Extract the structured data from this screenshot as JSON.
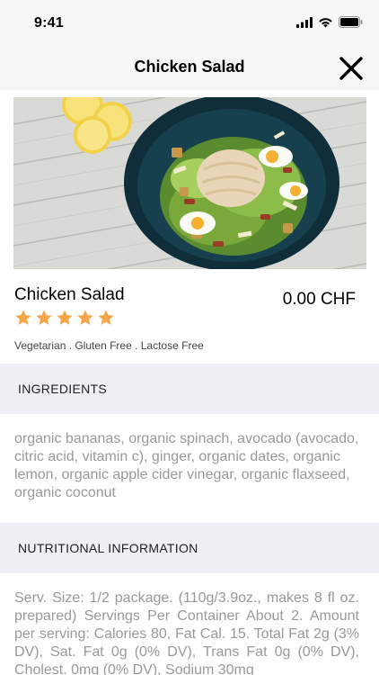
{
  "status_bar": {
    "time": "9:41",
    "icons": [
      "signal-icon",
      "wifi-icon",
      "battery-icon"
    ]
  },
  "nav": {
    "title": "Chicken Salad",
    "close_icon": "close-icon"
  },
  "product": {
    "image": "chicken-salad-photo",
    "name": "Chicken Salad",
    "price": "0.00 CHF",
    "rating": 5,
    "tags": "Vegetarian . Gluten Free . Lactose Free",
    "star_color": "#f2a649"
  },
  "ingredients": {
    "header": "INGREDIENTS",
    "text": "organic bananas, organic spinach, avocado (avocado, citric acid, vitamin c), ginger, organic dates, organic lemon, organic apple cider vinegar, organic flaxseed, organic coconut"
  },
  "nutrition": {
    "header": "NUTRITIONAL INFORMATION",
    "text": "Serv. Size: 1/2 package. (110g/3.9oz., makes 8 fl oz. prepared) Servings Per Container About 2. Amount per serving: Calories 80, Fat Cal. 15. Total Fat 2g (3% DV), Sat. Fat 0g (0% DV), Trans Fat 0g (0% DV), Cholest. 0mg (0% DV), Sodium 30mg"
  },
  "colors": {
    "section_bg": "#efeff4",
    "muted_text": "#999999",
    "bar_bg": "#f7f7f7"
  }
}
